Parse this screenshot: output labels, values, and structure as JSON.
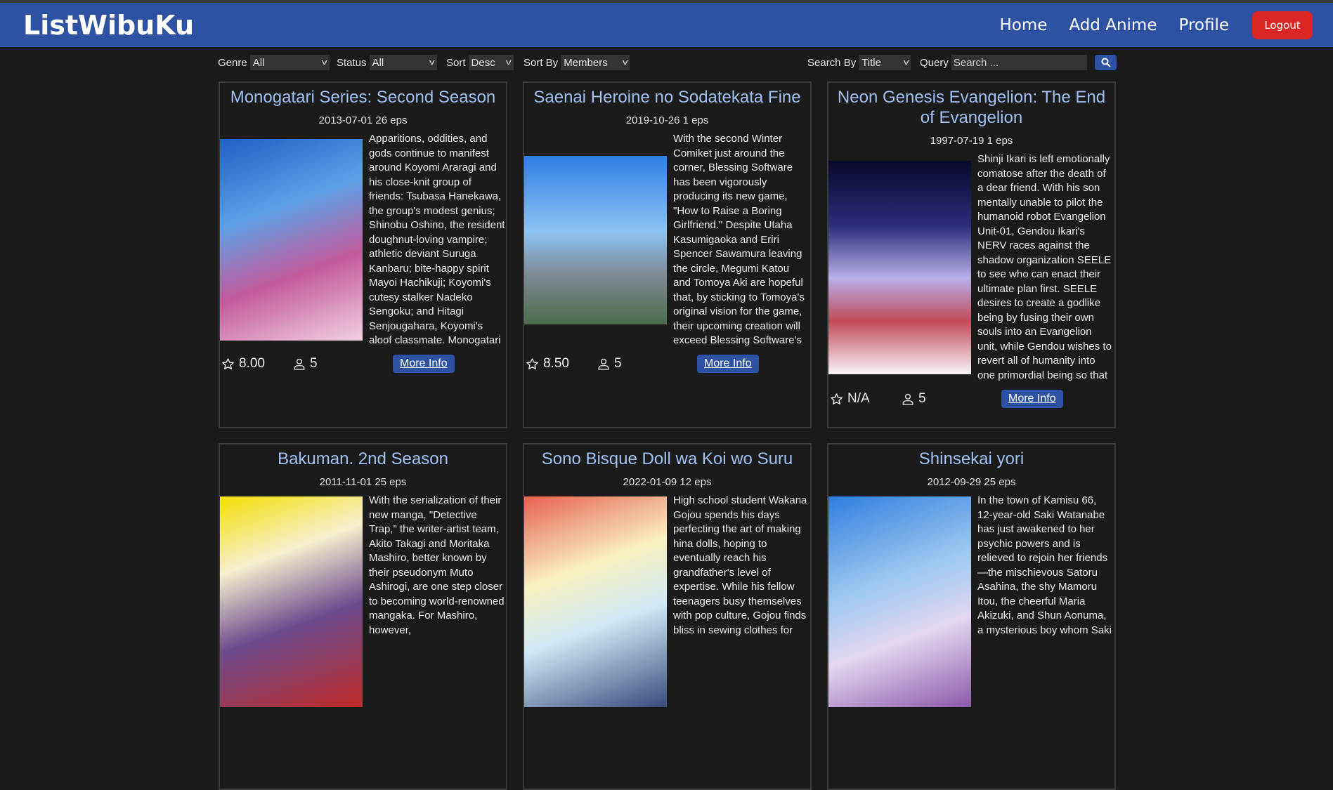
{
  "header": {
    "logo": "ListWibuKu",
    "nav": [
      "Home",
      "Add Anime",
      "Profile"
    ],
    "logout": "Logout",
    "brand_color": "#2d52a3",
    "logout_color": "#dc2626"
  },
  "filters": {
    "genre_label": "Genre",
    "genre_value": "All",
    "status_label": "Status",
    "status_value": "All",
    "sort_label": "Sort",
    "sort_value": "Desc",
    "sortby_label": "Sort By",
    "sortby_value": "Members",
    "searchby_label": "Search By",
    "searchby_value": "Title",
    "query_label": "Query",
    "query_placeholder": "Search ...",
    "search_icon": "search-icon"
  },
  "more_info_label": "More Info",
  "anime": [
    {
      "title": "Monogatari Series: Second Season",
      "date": "2013-07-01",
      "eps": "26 eps",
      "score": "8.00",
      "members": "5",
      "desc": "Apparitions, oddities, and gods continue to manifest around Koyomi Araragi and his close-knit group of friends: Tsubasa Hanekawa, the group's modest genius; Shinobu Oshino, the resident doughnut-loving vampire; athletic deviant Suruga Kanbaru; bite-happy spirit Mayoi Hachikuji; Koyomi's cutesy stalker Nadeko Sengoku; and Hitagi Senjougahara, Koyomi's aloof classmate. Monogatari Series: Second Season revolves around these individuals and their struggle to overcome the darkness"
    },
    {
      "title": "Saenai Heroine no Sodatekata Fine",
      "date": "2019-10-26",
      "eps": "1 eps",
      "score": "8.50",
      "members": "5",
      "desc": "With the second Winter Comiket just around the corner, Blessing Software has been vigorously producing its new game, \"How to Raise a Boring Girlfriend.\" Despite Utaha Kasumigaoka and Eriri Spencer Sawamura leaving the circle, Megumi Katou and Tomoya Aki are hopeful that, by sticking to Tomoya's original vision for the game, their upcoming creation will exceed Blessing Software's previous installment. With the addition of new members Iori and Izumi Hashima, development"
    },
    {
      "title": "Neon Genesis Evangelion: The End of Evangelion",
      "date": "1997-07-19",
      "eps": "1 eps",
      "score": "N/A",
      "members": "5",
      "desc": "Shinji Ikari is left emotionally comatose after the death of a dear friend. With his son mentally unable to pilot the humanoid robot Evangelion Unit-01, Gendou Ikari's NERV races against the shadow organization SEELE to see who can enact their ultimate plan first. SEELE desires to create a godlike being by fusing their own souls into an Evangelion unit, while Gendou wishes to revert all of humanity into one primordial being so that he can be reunited with Yui, his deceased wife. SEELE unleashes its military forces"
    },
    {
      "title": "Bakuman. 2nd Season",
      "date": "2011-11-01",
      "eps": "25 eps",
      "desc": "With the serialization of their new manga, \"Detective Trap,\" the writer-artist team, Akito Takagi and Moritaka Mashiro, better known by their pseudonym Muto Ashirogi, are one step closer to becoming world-renowned mangaka. For Mashiro, however,"
    },
    {
      "title": "Sono Bisque Doll wa Koi wo Suru",
      "date": "2022-01-09",
      "eps": "12 eps",
      "desc": "High school student Wakana Gojou spends his days perfecting the art of making hina dolls, hoping to eventually reach his grandfather's level of expertise. While his fellow teenagers busy themselves with pop culture, Gojou finds bliss in sewing clothes for"
    },
    {
      "title": "Shinsekai yori",
      "date": "2012-09-29",
      "eps": "25 eps",
      "desc": "In the town of Kamisu 66, 12-year-old Saki Watanabe has just awakened to her psychic powers and is relieved to rejoin her friends—the mischievous Satoru Asahina, the shy Mamoru Itou, the cheerful Maria Akizuki, and Shun Aonuma, a mysterious boy whom Saki"
    }
  ]
}
